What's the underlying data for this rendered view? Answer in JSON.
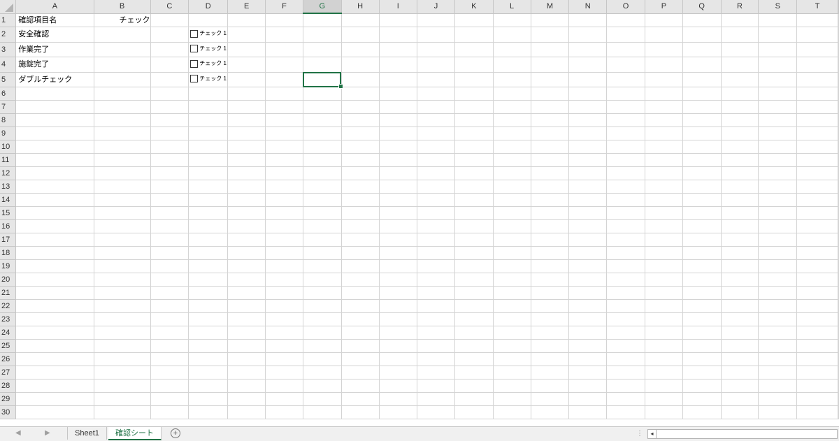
{
  "columns": [
    "A",
    "B",
    "C",
    "D",
    "E",
    "F",
    "G",
    "H",
    "I",
    "J",
    "K",
    "L",
    "M",
    "N",
    "O",
    "P",
    "Q",
    "R",
    "S",
    "T"
  ],
  "active_column": "G",
  "row_count": 30,
  "cells": {
    "A1": "確認項目名",
    "B1": "チェック",
    "A2": "安全確認",
    "A3": "作業完了",
    "A4": "施錠完了",
    "A5": "ダブルチェック"
  },
  "checkboxes": {
    "D2": "チェック 1",
    "D3": "チェック 1",
    "D4": "チェック 1",
    "D5": "チェック 1"
  },
  "selected_cell": "G5",
  "sheet_tabs": [
    {
      "label": "Sheet1",
      "active": false
    },
    {
      "label": "確認シート",
      "active": true
    }
  ],
  "add_sheet_symbol": "+",
  "nav_prev": "◀",
  "nav_next": "▶",
  "colors": {
    "accent": "#217346",
    "grid": "#d4d4d4",
    "header_bg": "#e6e6e6"
  }
}
